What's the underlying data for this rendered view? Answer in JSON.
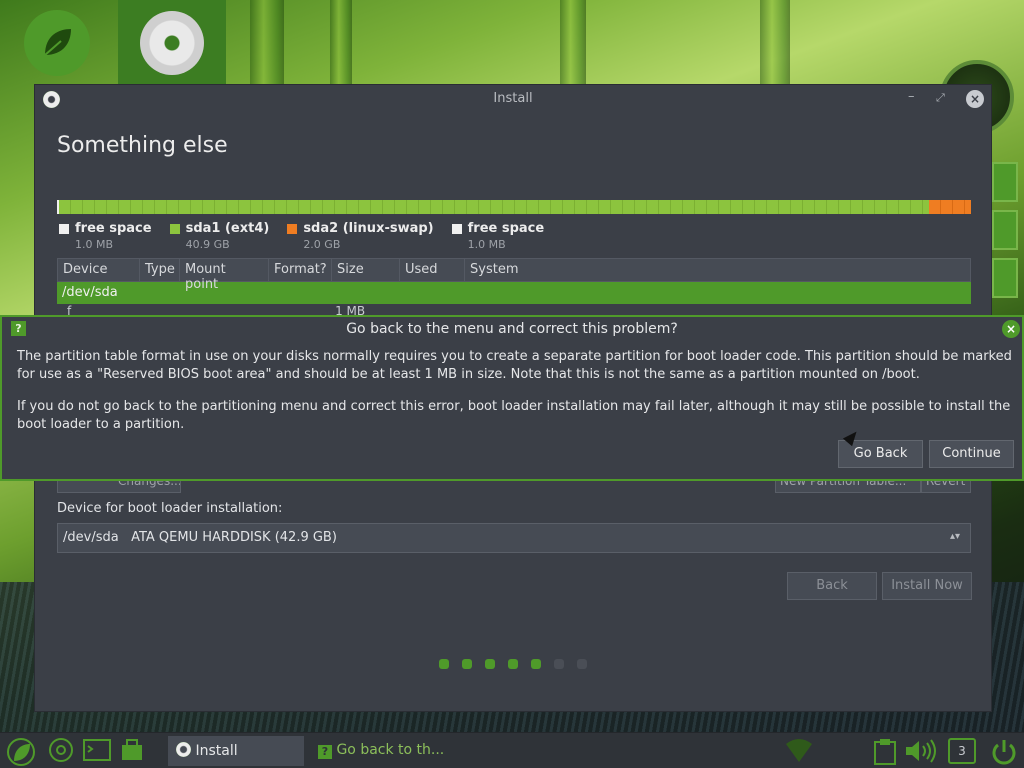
{
  "window": {
    "title": "Install",
    "min_glyph": "–",
    "max_glyph": "⤢",
    "close_glyph": "×"
  },
  "page": {
    "title": "Something else"
  },
  "partition_bar": {
    "segments": [
      {
        "label": "free space",
        "size": "1.0 MB",
        "color": "#f0f0f0"
      },
      {
        "label": "sda1 (ext4)",
        "size": "40.9 GB",
        "color": "#8cc43e"
      },
      {
        "label": "sda2 (linux-swap)",
        "size": "2.0 GB",
        "color": "#ef7d22"
      },
      {
        "label": "free space",
        "size": "1.0 MB",
        "color": "#f0f0f0"
      }
    ]
  },
  "table": {
    "headers": [
      "Device",
      "Type",
      "Mount point",
      "Format?",
      "Size",
      "Used",
      "System"
    ],
    "selected_row": "/dev/sda",
    "peek_row": {
      "device": "f",
      "size": "1 MB"
    }
  },
  "hidden_buttons": {
    "changes": "Changes...",
    "new_partition_table": "New Partition Table...",
    "revert": "Revert"
  },
  "boot_loader": {
    "label": "Device for boot loader installation:",
    "value": "/dev/sda   ATA QEMU HARDDISK (42.9 GB)",
    "arrow": "▴▾"
  },
  "footer": {
    "back": "Back",
    "install_now": "Install Now"
  },
  "progress": {
    "total_steps": 7,
    "completed_steps": 5
  },
  "dialog": {
    "title": "Go back to the menu and correct this problem?",
    "help_glyph": "?",
    "close_glyph": "×",
    "paragraph1": "The partition table format in use on your disks normally requires you to create a separate partition for boot loader code. This partition should be marked for use as a \"Reserved BIOS boot area\" and should be at least 1 MB in size. Note that this is not the same as a partition mounted on /boot.",
    "paragraph2": "If you do not go back to the partitioning menu and correct this error, boot loader installation may fail later, although it may still be possible to install the boot loader to a partition.",
    "go_back": "Go Back",
    "continue": "Continue"
  },
  "taskbar": {
    "tasks": [
      {
        "label": "Install",
        "active": true
      },
      {
        "label": "Go back to th...",
        "active": false
      }
    ],
    "workspace": "3"
  },
  "colors": {
    "accent": "#4f9a2a",
    "window_bg": "#3b3f47",
    "swap": "#ef7d22"
  }
}
